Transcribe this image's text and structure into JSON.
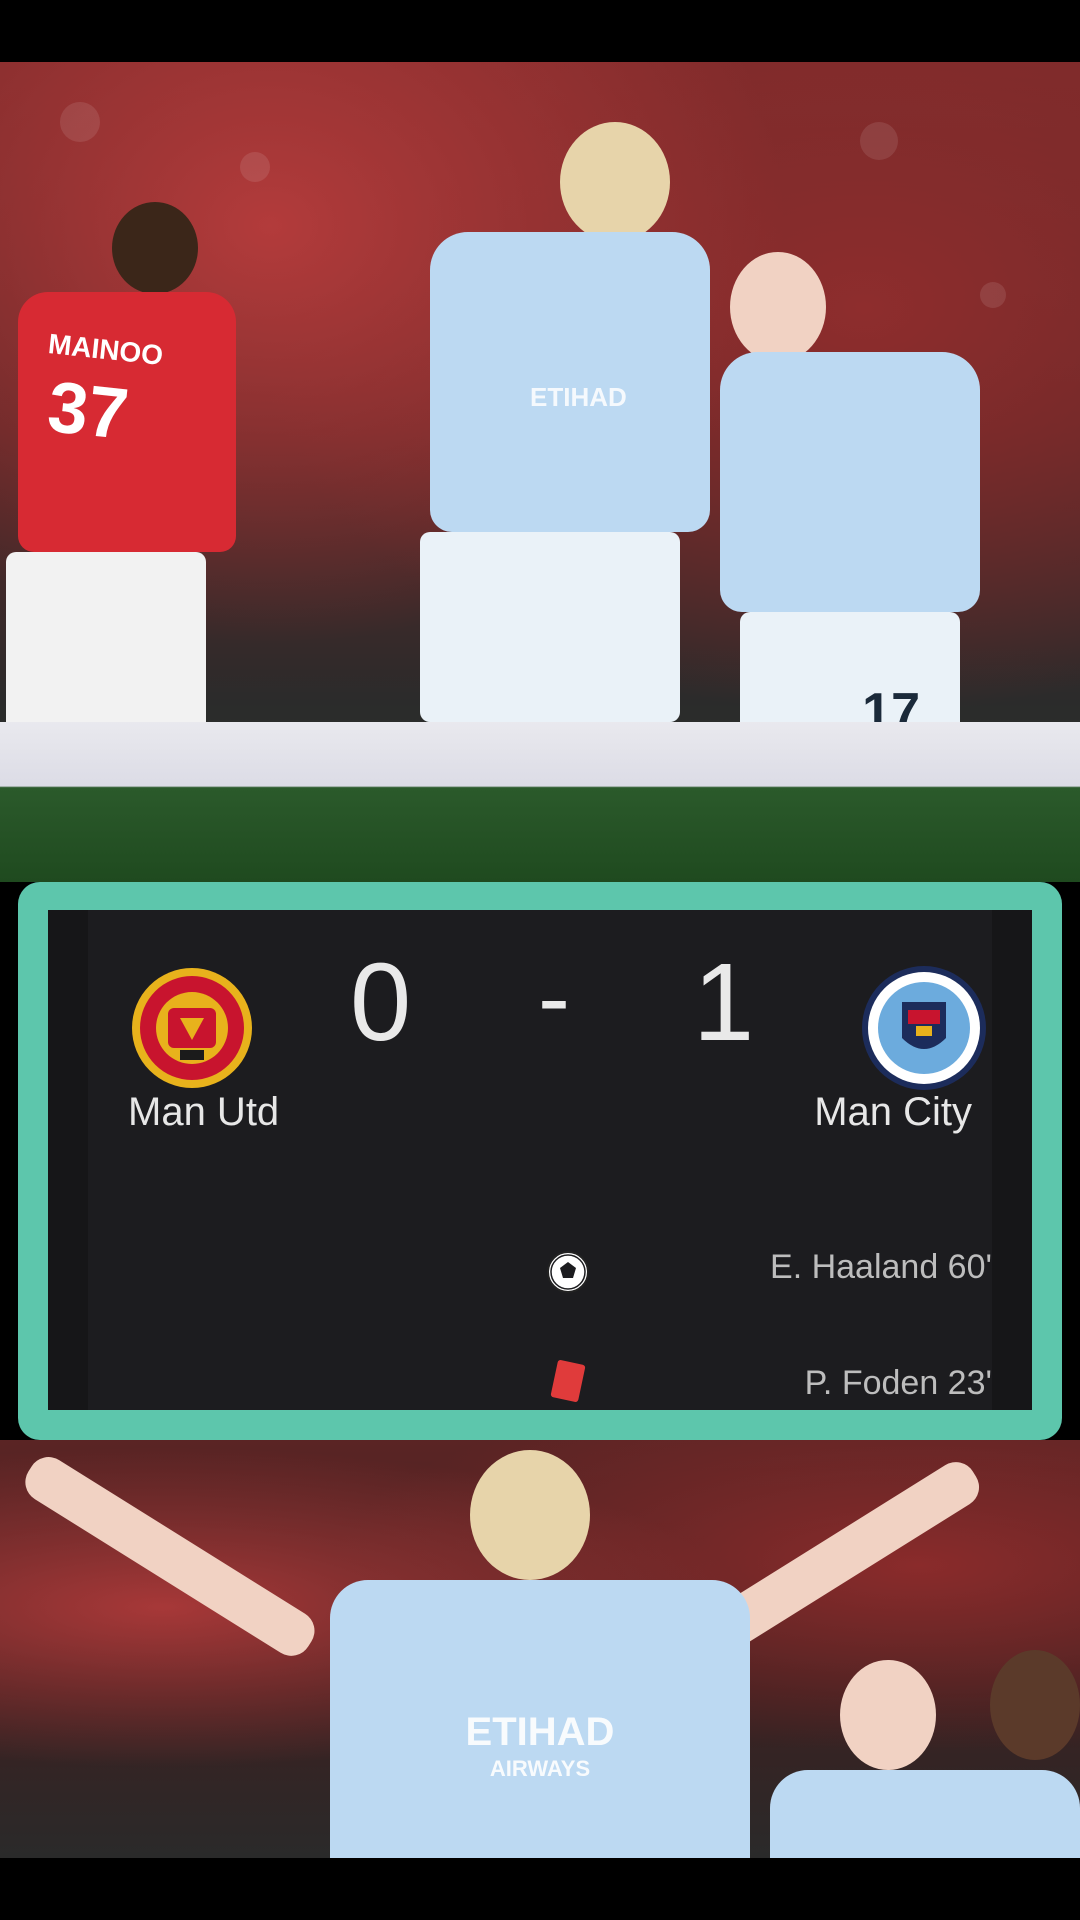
{
  "scoreboard": {
    "home_team": "Man Utd",
    "away_team": "Man City",
    "home_score": "0",
    "separator": "-",
    "away_score": "1",
    "events": [
      {
        "type": "goal",
        "icon": "soccer-ball-icon",
        "text": "E. Haaland 60'"
      },
      {
        "type": "red_card",
        "icon": "red-card-icon",
        "text": "P. Foden 23'"
      }
    ],
    "accent_color": "#5dc6ac"
  },
  "photo_top": {
    "shirt_text": "MAINOO",
    "shirt_number": "37",
    "player_number_right": "17"
  },
  "photo_bottom": {
    "shirt_sponsor_line1": "ETIHAD",
    "shirt_sponsor_line2": "AIRWAYS"
  }
}
